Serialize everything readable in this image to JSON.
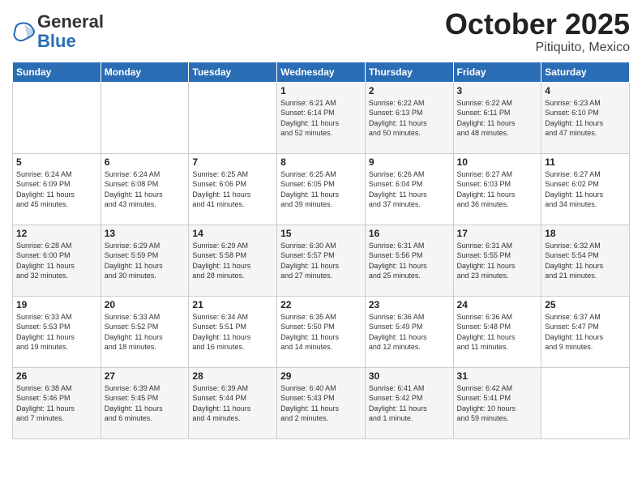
{
  "header": {
    "logo_general": "General",
    "logo_blue": "Blue",
    "month_title": "October 2025",
    "location": "Pitiquito, Mexico"
  },
  "weekdays": [
    "Sunday",
    "Monday",
    "Tuesday",
    "Wednesday",
    "Thursday",
    "Friday",
    "Saturday"
  ],
  "weeks": [
    [
      {
        "day": "",
        "info": ""
      },
      {
        "day": "",
        "info": ""
      },
      {
        "day": "",
        "info": ""
      },
      {
        "day": "1",
        "info": "Sunrise: 6:21 AM\nSunset: 6:14 PM\nDaylight: 11 hours\nand 52 minutes."
      },
      {
        "day": "2",
        "info": "Sunrise: 6:22 AM\nSunset: 6:13 PM\nDaylight: 11 hours\nand 50 minutes."
      },
      {
        "day": "3",
        "info": "Sunrise: 6:22 AM\nSunset: 6:11 PM\nDaylight: 11 hours\nand 48 minutes."
      },
      {
        "day": "4",
        "info": "Sunrise: 6:23 AM\nSunset: 6:10 PM\nDaylight: 11 hours\nand 47 minutes."
      }
    ],
    [
      {
        "day": "5",
        "info": "Sunrise: 6:24 AM\nSunset: 6:09 PM\nDaylight: 11 hours\nand 45 minutes."
      },
      {
        "day": "6",
        "info": "Sunrise: 6:24 AM\nSunset: 6:08 PM\nDaylight: 11 hours\nand 43 minutes."
      },
      {
        "day": "7",
        "info": "Sunrise: 6:25 AM\nSunset: 6:06 PM\nDaylight: 11 hours\nand 41 minutes."
      },
      {
        "day": "8",
        "info": "Sunrise: 6:25 AM\nSunset: 6:05 PM\nDaylight: 11 hours\nand 39 minutes."
      },
      {
        "day": "9",
        "info": "Sunrise: 6:26 AM\nSunset: 6:04 PM\nDaylight: 11 hours\nand 37 minutes."
      },
      {
        "day": "10",
        "info": "Sunrise: 6:27 AM\nSunset: 6:03 PM\nDaylight: 11 hours\nand 36 minutes."
      },
      {
        "day": "11",
        "info": "Sunrise: 6:27 AM\nSunset: 6:02 PM\nDaylight: 11 hours\nand 34 minutes."
      }
    ],
    [
      {
        "day": "12",
        "info": "Sunrise: 6:28 AM\nSunset: 6:00 PM\nDaylight: 11 hours\nand 32 minutes."
      },
      {
        "day": "13",
        "info": "Sunrise: 6:29 AM\nSunset: 5:59 PM\nDaylight: 11 hours\nand 30 minutes."
      },
      {
        "day": "14",
        "info": "Sunrise: 6:29 AM\nSunset: 5:58 PM\nDaylight: 11 hours\nand 28 minutes."
      },
      {
        "day": "15",
        "info": "Sunrise: 6:30 AM\nSunset: 5:57 PM\nDaylight: 11 hours\nand 27 minutes."
      },
      {
        "day": "16",
        "info": "Sunrise: 6:31 AM\nSunset: 5:56 PM\nDaylight: 11 hours\nand 25 minutes."
      },
      {
        "day": "17",
        "info": "Sunrise: 6:31 AM\nSunset: 5:55 PM\nDaylight: 11 hours\nand 23 minutes."
      },
      {
        "day": "18",
        "info": "Sunrise: 6:32 AM\nSunset: 5:54 PM\nDaylight: 11 hours\nand 21 minutes."
      }
    ],
    [
      {
        "day": "19",
        "info": "Sunrise: 6:33 AM\nSunset: 5:53 PM\nDaylight: 11 hours\nand 19 minutes."
      },
      {
        "day": "20",
        "info": "Sunrise: 6:33 AM\nSunset: 5:52 PM\nDaylight: 11 hours\nand 18 minutes."
      },
      {
        "day": "21",
        "info": "Sunrise: 6:34 AM\nSunset: 5:51 PM\nDaylight: 11 hours\nand 16 minutes."
      },
      {
        "day": "22",
        "info": "Sunrise: 6:35 AM\nSunset: 5:50 PM\nDaylight: 11 hours\nand 14 minutes."
      },
      {
        "day": "23",
        "info": "Sunrise: 6:36 AM\nSunset: 5:49 PM\nDaylight: 11 hours\nand 12 minutes."
      },
      {
        "day": "24",
        "info": "Sunrise: 6:36 AM\nSunset: 5:48 PM\nDaylight: 11 hours\nand 11 minutes."
      },
      {
        "day": "25",
        "info": "Sunrise: 6:37 AM\nSunset: 5:47 PM\nDaylight: 11 hours\nand 9 minutes."
      }
    ],
    [
      {
        "day": "26",
        "info": "Sunrise: 6:38 AM\nSunset: 5:46 PM\nDaylight: 11 hours\nand 7 minutes."
      },
      {
        "day": "27",
        "info": "Sunrise: 6:39 AM\nSunset: 5:45 PM\nDaylight: 11 hours\nand 6 minutes."
      },
      {
        "day": "28",
        "info": "Sunrise: 6:39 AM\nSunset: 5:44 PM\nDaylight: 11 hours\nand 4 minutes."
      },
      {
        "day": "29",
        "info": "Sunrise: 6:40 AM\nSunset: 5:43 PM\nDaylight: 11 hours\nand 2 minutes."
      },
      {
        "day": "30",
        "info": "Sunrise: 6:41 AM\nSunset: 5:42 PM\nDaylight: 11 hours\nand 1 minute."
      },
      {
        "day": "31",
        "info": "Sunrise: 6:42 AM\nSunset: 5:41 PM\nDaylight: 10 hours\nand 59 minutes."
      },
      {
        "day": "",
        "info": ""
      }
    ]
  ]
}
